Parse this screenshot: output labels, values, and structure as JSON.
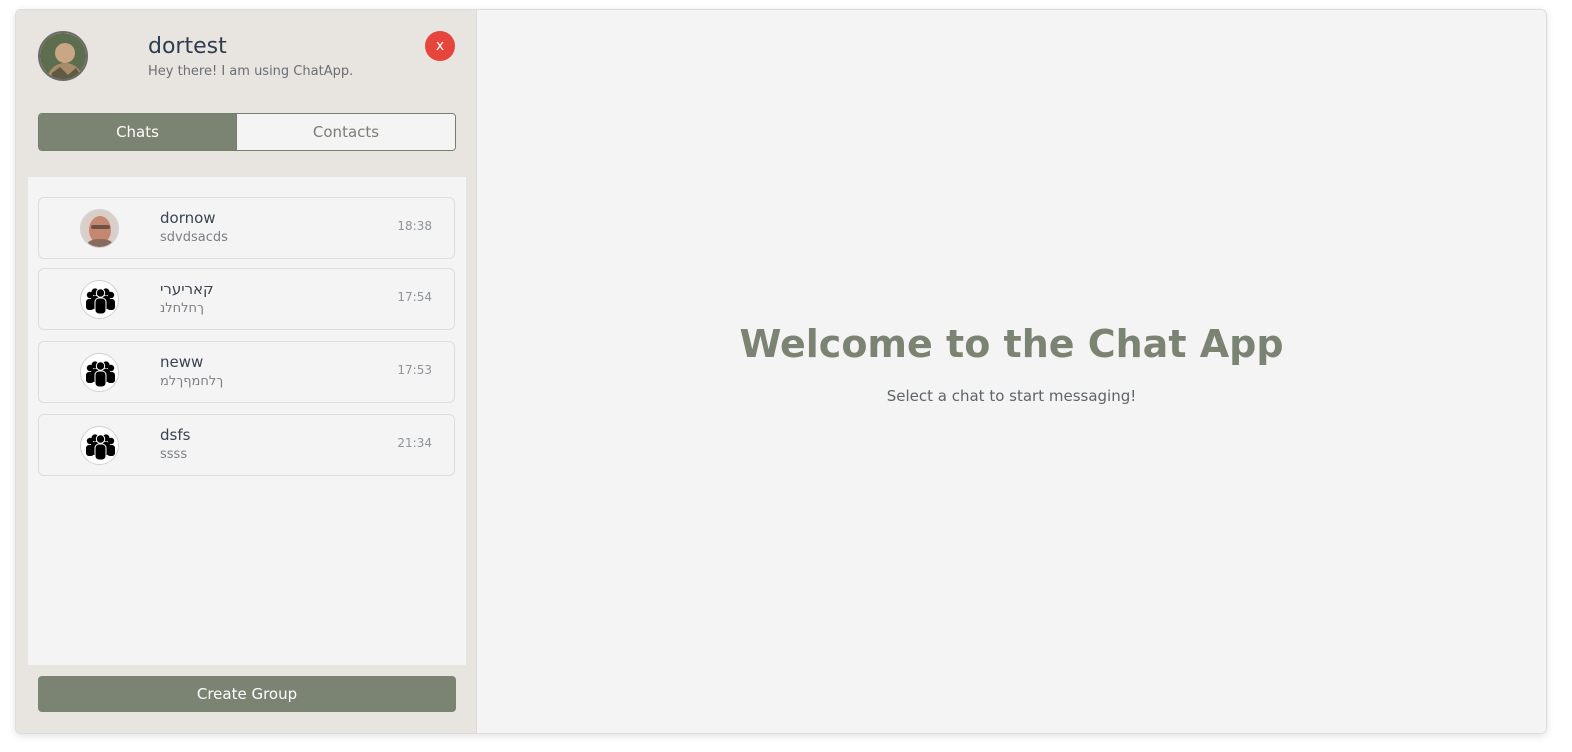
{
  "profile": {
    "name": "dortest",
    "status": "Hey there! I am using ChatApp.",
    "avatar_icon": "user-photo-avatar"
  },
  "header": {
    "close_label": "x",
    "close_color": "#e5453a"
  },
  "tabs": [
    {
      "label": "Chats",
      "active": true
    },
    {
      "label": "Contacts",
      "active": false
    }
  ],
  "chats": [
    {
      "name": "dornow",
      "preview": "sdvdsacds",
      "time": "18:38",
      "avatar": "user-photo-avatar"
    },
    {
      "name": "קאריערי",
      "preview": "ךחלחלנ",
      "time": "17:54",
      "avatar": "group-icon"
    },
    {
      "name": "neww",
      "preview": "ךלחמףךלמ",
      "time": "17:53",
      "avatar": "group-icon"
    },
    {
      "name": "dsfs",
      "preview": "ssss",
      "time": "21:34",
      "avatar": "group-icon"
    }
  ],
  "footer": {
    "create_group_label": "Create Group"
  },
  "main": {
    "welcome_title": "Welcome to the Chat App",
    "welcome_subtitle": "Select a chat to start messaging!"
  },
  "colors": {
    "accent": "#7b8472",
    "sidebar_bg": "#e8e4df",
    "panel_bg": "#f4f4f4"
  }
}
